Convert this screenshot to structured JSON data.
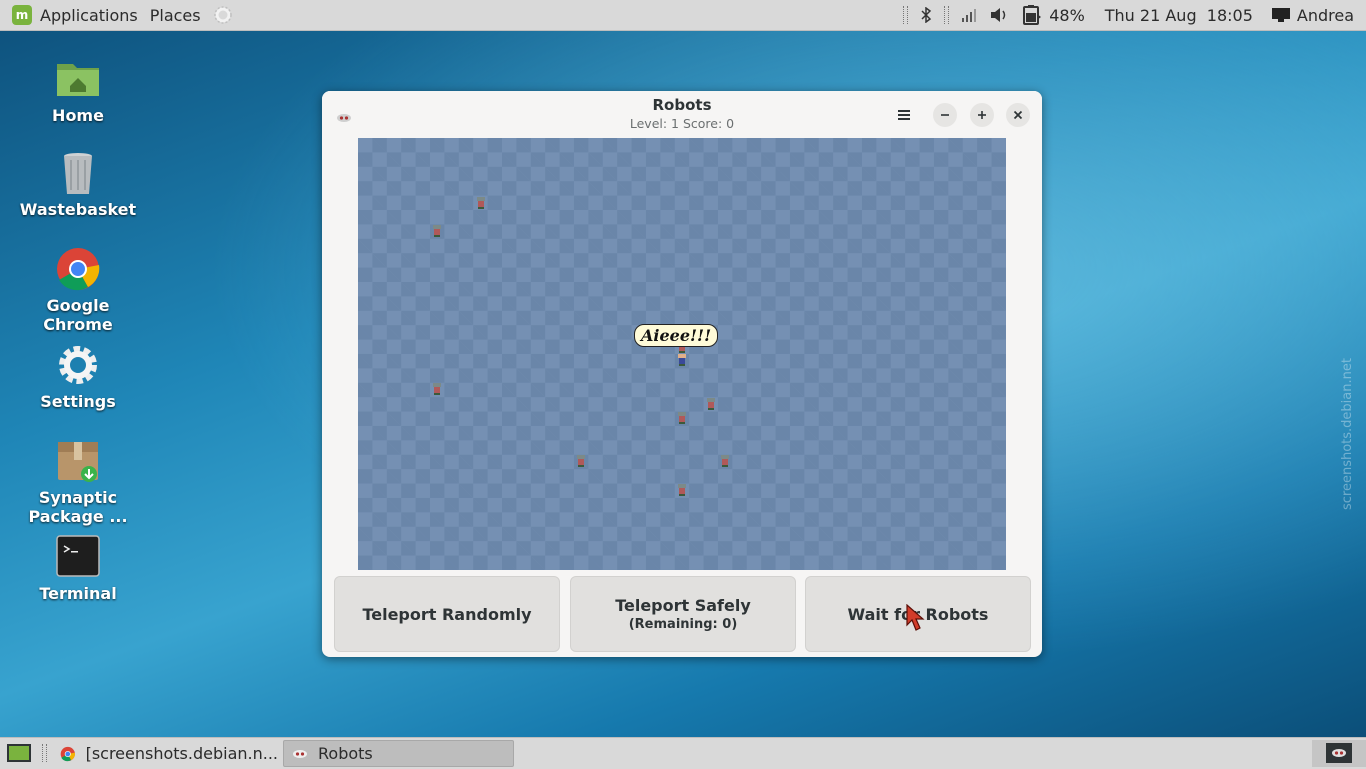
{
  "top_panel": {
    "applications": "Applications",
    "places": "Places",
    "battery": "48%",
    "datetime": "Thu 21 Aug  18:05",
    "user": "Andrea"
  },
  "desktop_icons": [
    {
      "label": "Home",
      "icon": "folder-home-icon"
    },
    {
      "label": "Wastebasket",
      "icon": "trash-icon"
    },
    {
      "label": "Google Chrome",
      "icon": "chrome-icon"
    },
    {
      "label": "Settings",
      "icon": "gear-icon"
    },
    {
      "label": "Synaptic Package ...",
      "icon": "package-icon"
    },
    {
      "label": "Terminal",
      "icon": "terminal-icon"
    }
  ],
  "window": {
    "title": "Robots",
    "subtitle": "Level: 1 Score: 0",
    "speech_bubble": "Aieee!!!",
    "buttons": {
      "teleport_randomly": "Teleport Randomly",
      "teleport_safely": "Teleport Safely",
      "teleport_safely_sub": "(Remaining: 0)",
      "wait": "Wait for Robots"
    }
  },
  "taskbar": {
    "items": [
      {
        "label": "[screenshots.debian.n...",
        "icon": "chrome-icon"
      },
      {
        "label": "Robots",
        "icon": "robots-icon"
      }
    ]
  },
  "watermark": "screenshots.debian.net",
  "colors": {
    "board": "#7590b3",
    "panel": "#d9d9d9",
    "window_bg": "#f6f5f4"
  }
}
